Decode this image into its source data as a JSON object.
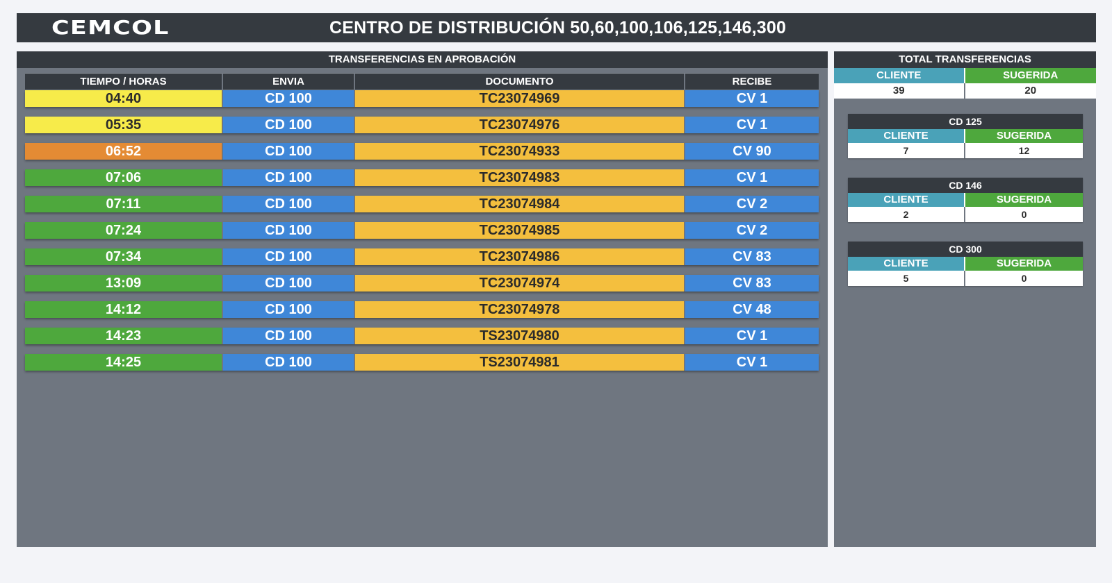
{
  "header": {
    "logo": "CEMCOL",
    "title": "CENTRO DE DISTRIBUCIÓN 50,60,100,106,125,146,300"
  },
  "transfers": {
    "panel_title": "TRANSFERENCIAS EN APROBACIÓN",
    "columns": [
      "TIEMPO / HORAS",
      "ENVIA",
      "DOCUMENTO",
      "RECIBE"
    ],
    "rows": [
      {
        "time": "04:40",
        "status": "yellow",
        "envia": "CD 100",
        "documento": "TC23074969",
        "recibe": "CV 1"
      },
      {
        "time": "05:35",
        "status": "yellow",
        "envia": "CD 100",
        "documento": "TC23074976",
        "recibe": "CV 1"
      },
      {
        "time": "06:52",
        "status": "orange",
        "envia": "CD 100",
        "documento": "TC23074933",
        "recibe": "CV 90"
      },
      {
        "time": "07:06",
        "status": "green",
        "envia": "CD 100",
        "documento": "TC23074983",
        "recibe": "CV 1"
      },
      {
        "time": "07:11",
        "status": "green",
        "envia": "CD 100",
        "documento": "TC23074984",
        "recibe": "CV 2"
      },
      {
        "time": "07:24",
        "status": "green",
        "envia": "CD 100",
        "documento": "TC23074985",
        "recibe": "CV 2"
      },
      {
        "time": "07:34",
        "status": "green",
        "envia": "CD 100",
        "documento": "TC23074986",
        "recibe": "CV 83"
      },
      {
        "time": "13:09",
        "status": "green",
        "envia": "CD 100",
        "documento": "TC23074974",
        "recibe": "CV 83"
      },
      {
        "time": "14:12",
        "status": "green",
        "envia": "CD 100",
        "documento": "TC23074978",
        "recibe": "CV 48"
      },
      {
        "time": "14:23",
        "status": "green",
        "envia": "CD 100",
        "documento": "TS23074980",
        "recibe": "CV 1"
      },
      {
        "time": "14:25",
        "status": "green",
        "envia": "CD 100",
        "documento": "TS23074981",
        "recibe": "CV 1"
      }
    ]
  },
  "totals": {
    "title": "TOTAL TRANSFERENCIAS",
    "cliente_label": "CLIENTE",
    "sugerida_label": "SUGERIDA",
    "cliente": "39",
    "sugerida": "20"
  },
  "cd_boxes": [
    {
      "title": "CD 125",
      "cliente_label": "CLIENTE",
      "sugerida_label": "SUGERIDA",
      "cliente": "7",
      "sugerida": "12"
    },
    {
      "title": "CD 146",
      "cliente_label": "CLIENTE",
      "sugerida_label": "SUGERIDA",
      "cliente": "2",
      "sugerida": "0"
    },
    {
      "title": "CD 300",
      "cliente_label": "CLIENTE",
      "sugerida_label": "SUGERIDA",
      "cliente": "5",
      "sugerida": "0"
    }
  ],
  "colors": {
    "yellow": "#f7eb4a",
    "orange": "#e48b34",
    "green": "#4ea83d",
    "blue": "#3f87d8",
    "document": "#f4bf3e",
    "dark": "#353a40",
    "panel": "#6f7680",
    "teal": "#4aa2b8"
  }
}
